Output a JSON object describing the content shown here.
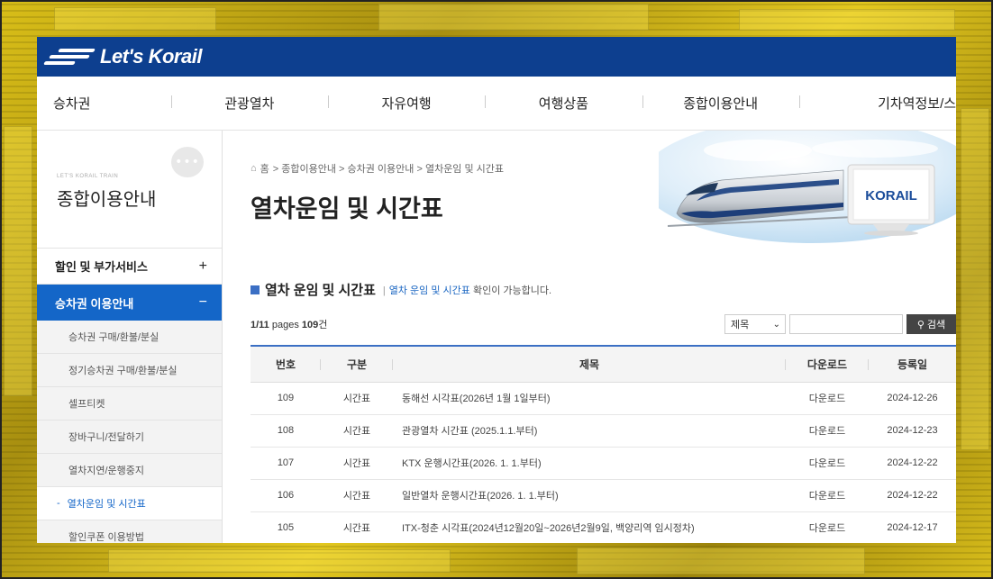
{
  "brand": {
    "logo_text": "Let's Korail",
    "accent": "#0d3f8f",
    "highlight": "#1466c8"
  },
  "gnb": [
    "승차권",
    "관광열차",
    "자유여행",
    "여행상품",
    "종합이용안내",
    "기차역정보/스"
  ],
  "lnb": {
    "sub_caption": "LET'S KORAIL TRAIN",
    "title": "종합이용안내",
    "groups": [
      {
        "label": "할인 및 부가서비스",
        "sign": "+"
      },
      {
        "label": "승차권 이용안내",
        "sign": "−"
      }
    ],
    "items": [
      "승차권 구매/환불/분실",
      "정기승차권 구매/환불/분실",
      "셀프티켓",
      "장바구니/전달하기",
      "열차지연/운행중지",
      "열차운임 및 시간표",
      "할인쿠폰 이용방법"
    ]
  },
  "breadcrumb": {
    "home": "홈",
    "path": "> 종합이용안내 > 승차권 이용안내 > 열차운임 및 시간표"
  },
  "page_title": "열차운임 및 시간표",
  "hero_badge": "KORAIL",
  "section": {
    "title": "열차 운임 및 시간표",
    "desc_sep": "|",
    "desc_link": "열차 운임 및 시간표",
    "desc_rest": " 확인이 가능합니다."
  },
  "pager": {
    "pages": "1/11",
    "pages_word": "pages",
    "count": "109",
    "count_unit": "건"
  },
  "search": {
    "select_value": "제목",
    "button_label": "검색"
  },
  "table": {
    "headers": [
      "번호",
      "구분",
      "제목",
      "다운로드",
      "등록일"
    ],
    "rows": [
      [
        "109",
        "시간표",
        "동해선 시각표(2026년 1월 1일부터)",
        "다운로드",
        "2024-12-26"
      ],
      [
        "108",
        "시간표",
        "관광열차 시간표 (2025.1.1.부터)",
        "다운로드",
        "2024-12-23"
      ],
      [
        "107",
        "시간표",
        "KTX 운행시간표(2026. 1. 1.부터)",
        "다운로드",
        "2024-12-22"
      ],
      [
        "106",
        "시간표",
        "일반열차 운행시간표(2026. 1. 1.부터)",
        "다운로드",
        "2024-12-22"
      ],
      [
        "105",
        "시간표",
        "ITX-청춘 시각표(2024년12월20일~2026년2월9일, 백양리역 임시정차)",
        "다운로드",
        "2024-12-17"
      ]
    ]
  }
}
